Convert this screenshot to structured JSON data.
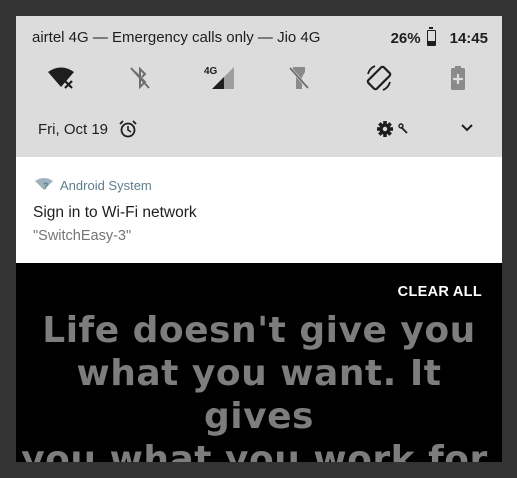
{
  "statusbar": {
    "carrier_text": "airtel 4G — Emergency calls only — Jio 4G",
    "battery_percent": "26%",
    "time": "14:45"
  },
  "quick_settings": {
    "tiles": [
      {
        "icon": "wifi-off-icon"
      },
      {
        "icon": "bluetooth-off-icon"
      },
      {
        "icon": "mobile-data-4g-icon",
        "label": "4G"
      },
      {
        "icon": "flashlight-off-icon"
      },
      {
        "icon": "auto-rotate-icon"
      },
      {
        "icon": "battery-saver-icon"
      }
    ],
    "date": "Fri, Oct 19"
  },
  "notification": {
    "app_name": "Android System",
    "title": "Sign in to Wi-Fi network",
    "text": "\"SwitchEasy-3\""
  },
  "clear_all_label": "CLEAR ALL",
  "wallpaper_quote": [
    "Life doesn't give you",
    "what you want. It gives",
    "you what you work for."
  ],
  "colors": {
    "quick_settings_bg": "#dcdcdc",
    "notification_bg": "#ffffff",
    "app_name_color": "#5f7d8a",
    "wallpaper_bg": "#000000",
    "quote_color": "#7d7d7d"
  }
}
